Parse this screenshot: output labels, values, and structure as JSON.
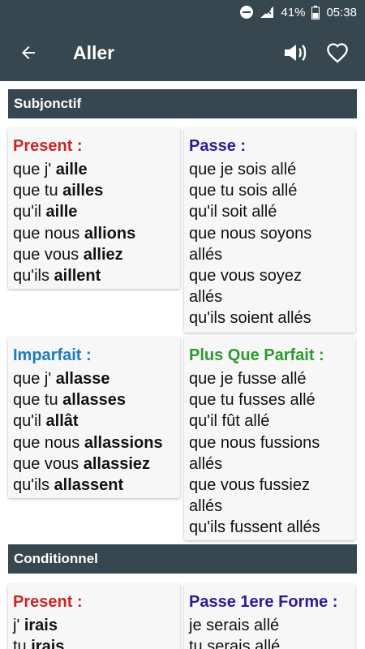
{
  "status_bar": {
    "battery": "41%",
    "time": "05:38"
  },
  "app_bar": {
    "title": "Aller"
  },
  "sections": [
    {
      "title": "Subjonctif",
      "cards": [
        {
          "tense": "Present :",
          "color": "#c62828",
          "lines": [
            {
              "pre": "que j' ",
              "stem": "aille"
            },
            {
              "pre": "que tu ",
              "stem": "ailles"
            },
            {
              "pre": "qu'il ",
              "stem": "aille"
            },
            {
              "pre": "que nous ",
              "stem": "allions"
            },
            {
              "pre": "que vous ",
              "stem": "alliez"
            },
            {
              "pre": "qu'ils ",
              "stem": "aillent"
            }
          ]
        },
        {
          "tense": "Passe :",
          "color": "#311b92",
          "lines": [
            {
              "pre": "que je sois allé",
              "stem": ""
            },
            {
              "pre": "que tu sois allé",
              "stem": ""
            },
            {
              "pre": "qu'il soit allé",
              "stem": ""
            },
            {
              "pre": "que nous soyons",
              "stem": ""
            },
            {
              "pre": "allés",
              "stem": ""
            },
            {
              "pre": "que vous soyez",
              "stem": ""
            },
            {
              "pre": "allés",
              "stem": ""
            },
            {
              "pre": "qu'ils soient allés",
              "stem": ""
            }
          ]
        },
        {
          "tense": "Imparfait :",
          "color": "#1e7bc0",
          "lines": [
            {
              "pre": "que j' ",
              "stem": "allasse"
            },
            {
              "pre": "que tu ",
              "stem": "allasses"
            },
            {
              "pre": "qu'il ",
              "stem": "allât"
            },
            {
              "pre": "que nous ",
              "stem": "allassions"
            },
            {
              "pre": "que vous ",
              "stem": "allassiez"
            },
            {
              "pre": "qu'ils ",
              "stem": "allassent"
            }
          ]
        },
        {
          "tense": "Plus Que Parfait :",
          "color": "#2e9a2e",
          "lines": [
            {
              "pre": "que je fusse allé",
              "stem": ""
            },
            {
              "pre": "que tu fusses allé",
              "stem": ""
            },
            {
              "pre": "qu'il fût allé",
              "stem": ""
            },
            {
              "pre": "que nous fussions",
              "stem": ""
            },
            {
              "pre": "allés",
              "stem": ""
            },
            {
              "pre": "que vous fussiez",
              "stem": ""
            },
            {
              "pre": "allés",
              "stem": ""
            },
            {
              "pre": "qu'ils fussent allés",
              "stem": ""
            }
          ]
        }
      ]
    },
    {
      "title": "Conditionnel",
      "cards": [
        {
          "tense": "Present :",
          "color": "#c62828",
          "lines": [
            {
              "pre": "j' ",
              "stem": "irais"
            },
            {
              "pre": "tu ",
              "stem": "irais"
            }
          ]
        },
        {
          "tense": "Passe 1ere Forme :",
          "color": "#311b92",
          "lines": [
            {
              "pre": "je serais allé",
              "stem": ""
            },
            {
              "pre": "tu serais allé",
              "stem": ""
            }
          ]
        }
      ]
    }
  ]
}
